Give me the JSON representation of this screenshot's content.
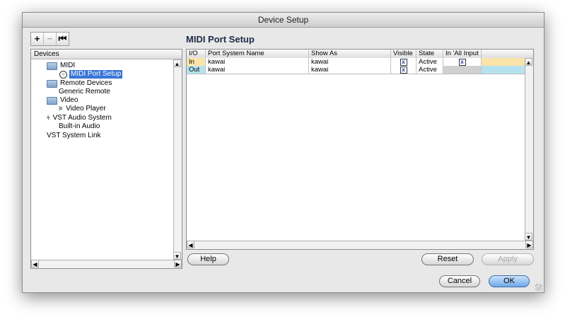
{
  "window": {
    "title": "Device Setup"
  },
  "toolbar": {
    "add": "+",
    "remove": "−",
    "reset_view": "⏮"
  },
  "panel": {
    "title": "MIDI Port Setup"
  },
  "devices": {
    "header": "Devices",
    "items": [
      {
        "label": "MIDI"
      },
      {
        "label": "MIDI Port Setup"
      },
      {
        "label": "Remote Devices"
      },
      {
        "label": "Generic Remote"
      },
      {
        "label": "Video"
      },
      {
        "label": "Video Player"
      },
      {
        "label": "VST Audio System"
      },
      {
        "label": "Built-in Audio"
      },
      {
        "label": "VST System Link"
      }
    ]
  },
  "ports": {
    "columns": [
      "I/O",
      "Port System Name",
      "Show As",
      "Visible",
      "State",
      "In 'All Input"
    ],
    "rows": [
      {
        "io": "In",
        "system_name": "kawai",
        "show_as": "kawai",
        "visible": "x",
        "state": "Active",
        "all_input": "x"
      },
      {
        "io": "Out",
        "system_name": "kawai",
        "show_as": "kawai",
        "visible": "x",
        "state": "Active",
        "all_input": ""
      }
    ]
  },
  "buttons": {
    "help": "Help",
    "reset": "Reset",
    "apply": "Apply",
    "cancel": "Cancel",
    "ok": "OK"
  },
  "colors": {
    "row_in": "#fbe4a8",
    "row_out": "#b4e3ef",
    "selection": "#3875d7",
    "default_button": "#6ea8e8"
  }
}
